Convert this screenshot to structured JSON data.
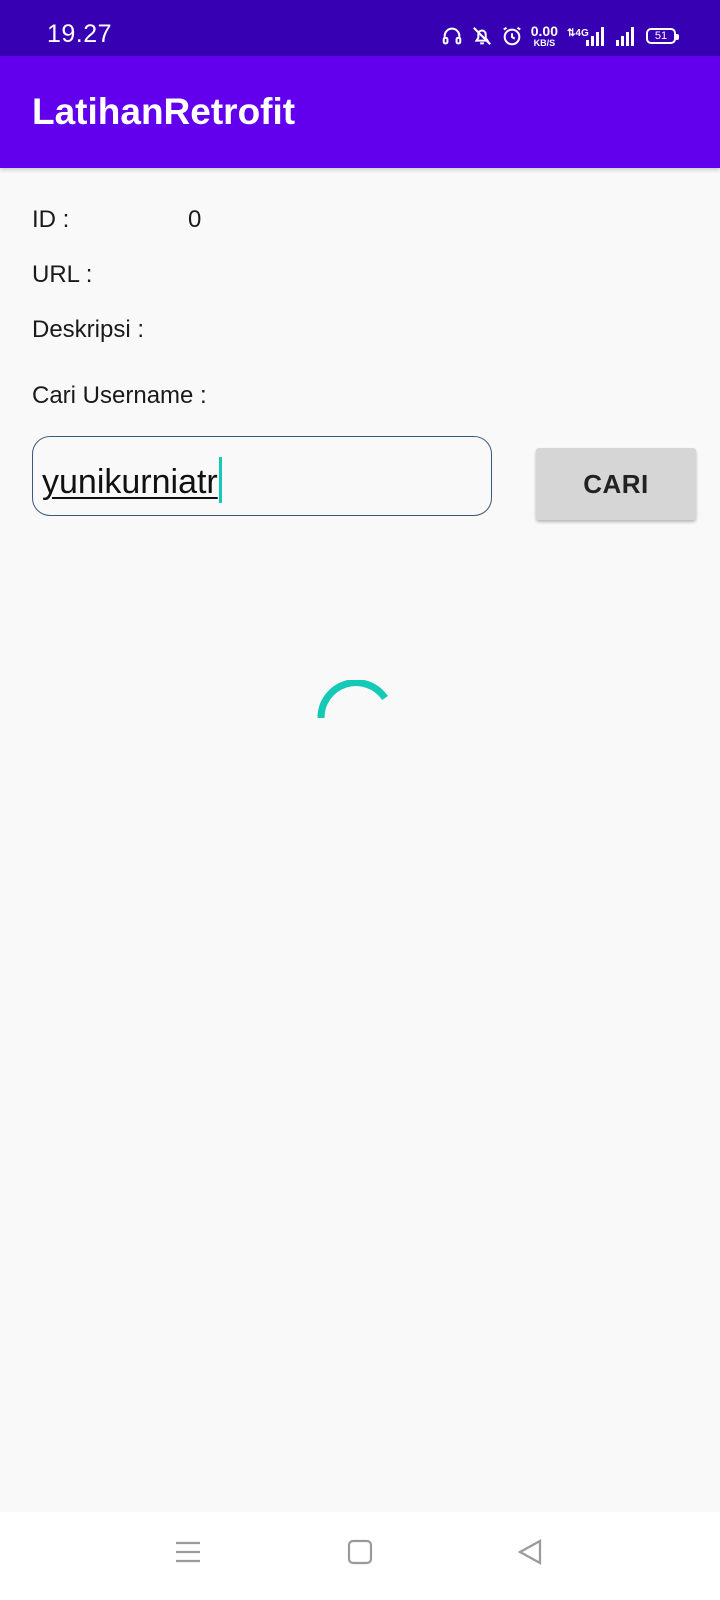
{
  "status_bar": {
    "time": "19.27",
    "net_speed_value": "0.00",
    "net_speed_unit": "KB/S",
    "network_type": "4G",
    "battery_level": "51",
    "icons": [
      "headphones-icon",
      "bell-off-icon",
      "alarm-icon",
      "data-arrows-icon",
      "signal-4g-icon",
      "signal-icon",
      "battery-icon"
    ]
  },
  "app_bar": {
    "title": "LatihanRetrofit"
  },
  "profile": {
    "id_label": "ID :",
    "id_value": "0",
    "url_label": "URL :",
    "description_label": "Deskripsi :"
  },
  "search": {
    "label": "Cari Username :",
    "value": "yunikurniatr",
    "button_label": "CARI"
  },
  "loading": {
    "spinner_color": "#14c9b5"
  },
  "nav": {
    "icons": [
      "menu-icon",
      "home-square-icon",
      "back-triangle-icon"
    ]
  },
  "colors": {
    "status_bar": "#3700b3",
    "app_bar": "#6200ee",
    "button": "#d6d6d6",
    "accent": "#14c9b5"
  }
}
